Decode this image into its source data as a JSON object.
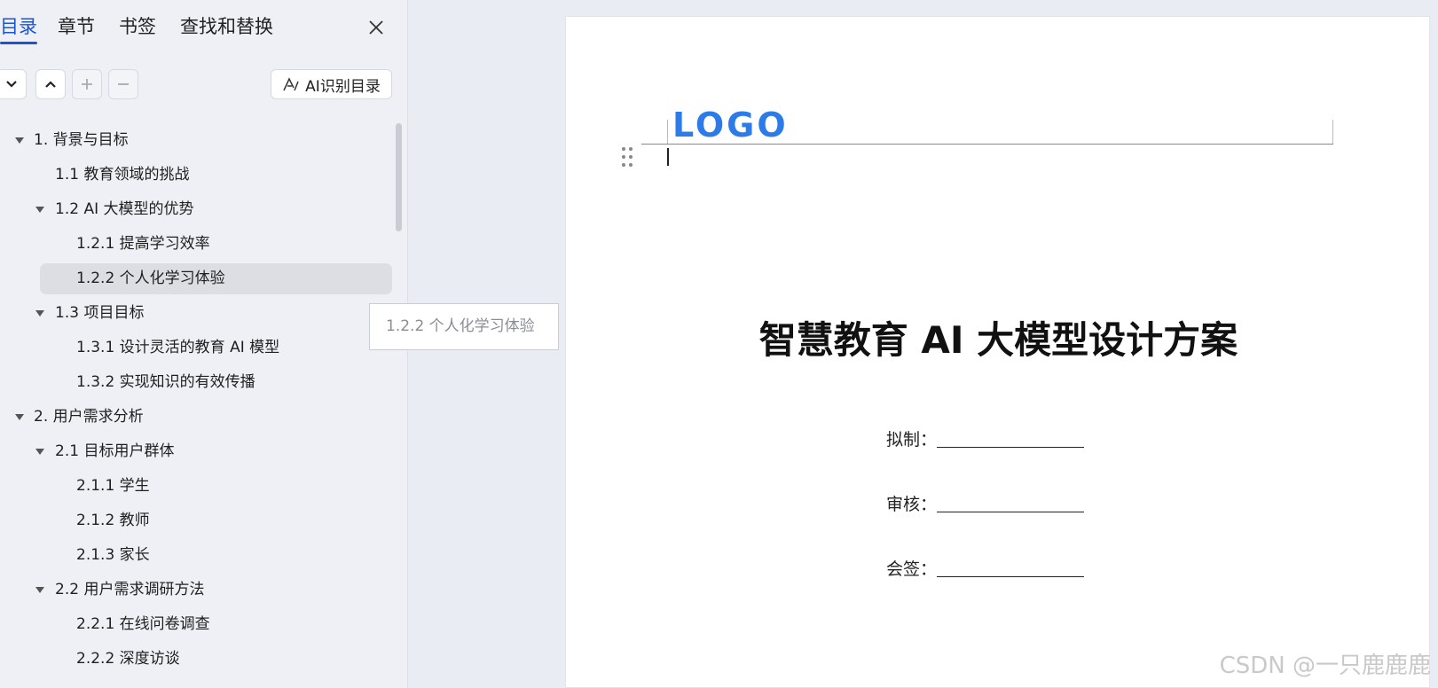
{
  "sidebar": {
    "tabs": [
      {
        "label": "目录",
        "active": true
      },
      {
        "label": "章节",
        "active": false
      },
      {
        "label": "书签",
        "active": false
      },
      {
        "label": "查找和替换",
        "active": false
      }
    ],
    "ai_toc_label": "AI识别目录",
    "toc": [
      {
        "label": "1. 背景与目标",
        "level": 1,
        "expandable": true
      },
      {
        "label": "1.1 教育领域的挑战",
        "level": 2,
        "expandable": false
      },
      {
        "label": "1.2 AI 大模型的优势",
        "level": 2,
        "expandable": true
      },
      {
        "label": "1.2.1 提高学习效率",
        "level": 3,
        "expandable": false
      },
      {
        "label": "1.2.2 个人化学习体验",
        "level": 3,
        "expandable": false,
        "selected": true
      },
      {
        "label": "1.3 项目目标",
        "level": 2,
        "expandable": true
      },
      {
        "label": "1.3.1 设计灵活的教育 AI 模型",
        "level": 3,
        "expandable": false
      },
      {
        "label": "1.3.2 实现知识的有效传播",
        "level": 3,
        "expandable": false
      },
      {
        "label": "2. 用户需求分析",
        "level": 1,
        "expandable": true
      },
      {
        "label": "2.1 目标用户群体",
        "level": 2,
        "expandable": true
      },
      {
        "label": "2.1.1 学生",
        "level": 3,
        "expandable": false
      },
      {
        "label": "2.1.2 教师",
        "level": 3,
        "expandable": false
      },
      {
        "label": "2.1.3 家长",
        "level": 3,
        "expandable": false
      },
      {
        "label": "2.2 用户需求调研方法",
        "level": 2,
        "expandable": true
      },
      {
        "label": "2.2.1 在线问卷调查",
        "level": 3,
        "expandable": false
      },
      {
        "label": "2.2.2 深度访谈",
        "level": 3,
        "expandable": false
      }
    ],
    "tooltip": "1.2.2 个人化学习体验"
  },
  "document": {
    "logo": "LOGO",
    "title": "智慧教育 AI 大模型设计方案",
    "sign_fields": [
      {
        "label": "拟制："
      },
      {
        "label": "审核："
      },
      {
        "label": "会签："
      }
    ]
  },
  "watermark": "CSDN @一只鹿鹿鹿",
  "colors": {
    "accent": "#1a55d6",
    "logo": "#2d7be8"
  }
}
